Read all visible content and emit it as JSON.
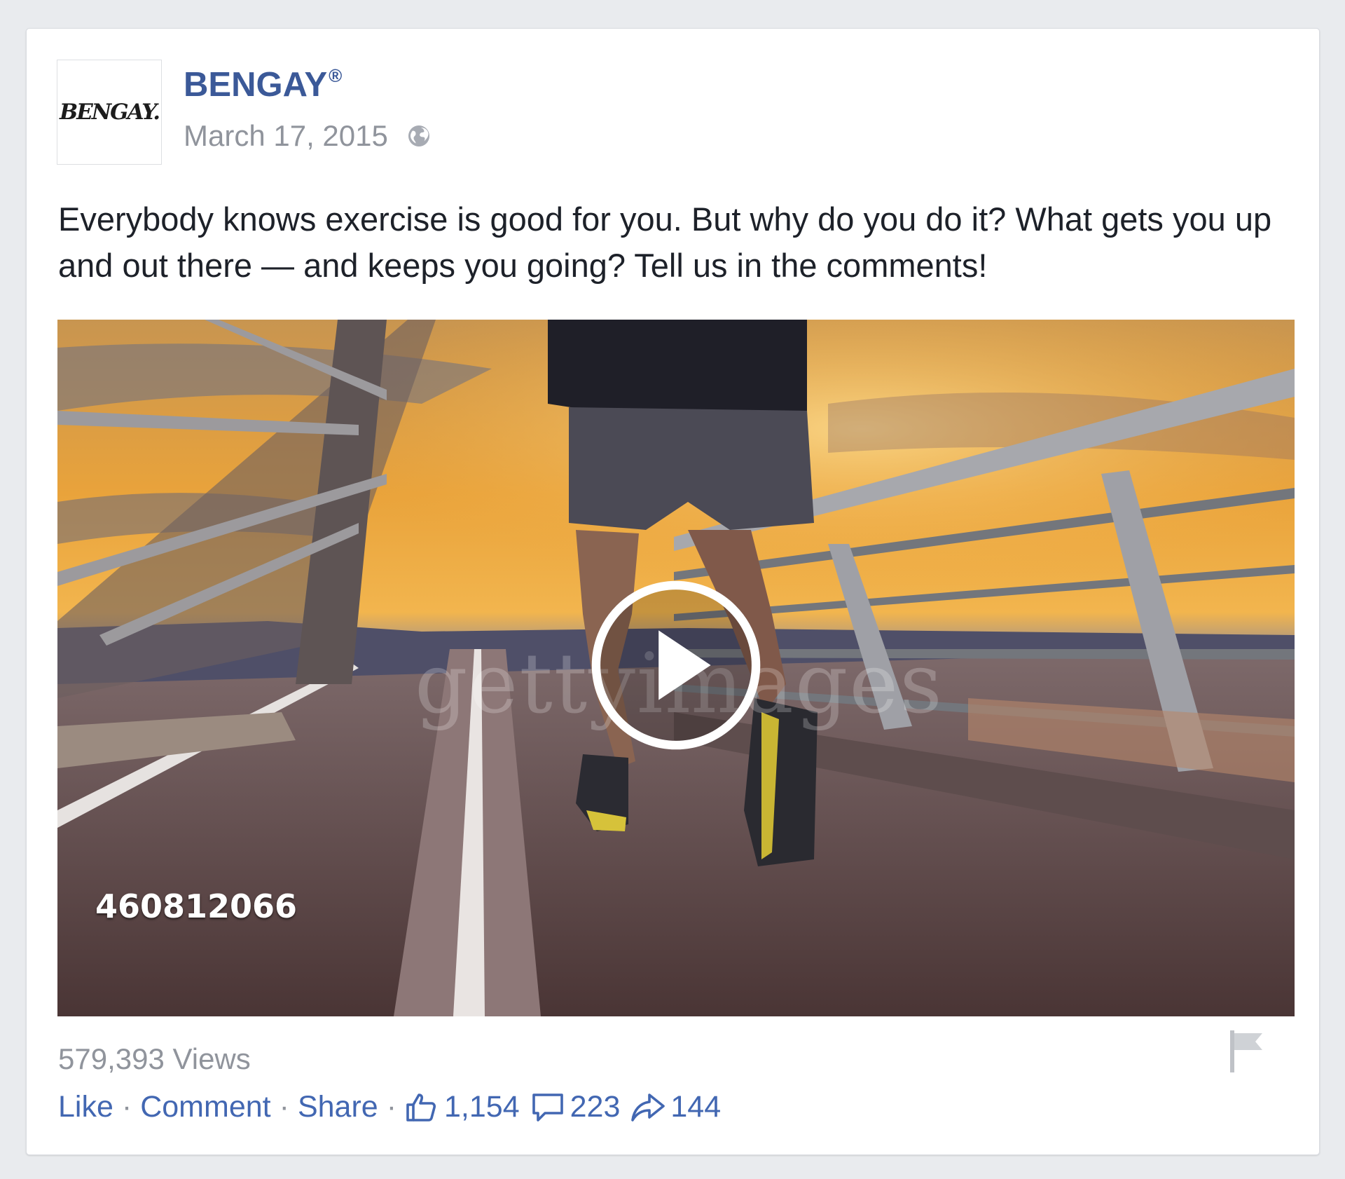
{
  "post": {
    "page_name": "BENGAY",
    "registered_mark": "®",
    "avatar_logo": "BENGAY.",
    "date": "March 17, 2015",
    "text": "Everybody knows exercise is good for you. But why do you do it? What gets you up and out there — and keeps you going? Tell us in the comments!"
  },
  "video": {
    "watermark": "gettyimages",
    "stock_id": "460812066"
  },
  "footer": {
    "views": "579,393 Views",
    "like_label": "Like",
    "comment_label": "Comment",
    "share_label": "Share",
    "separator": "·",
    "like_count": "1,154",
    "comment_count": "223",
    "share_count": "144"
  },
  "icons": {
    "privacy": "globe-icon",
    "play": "play-icon",
    "report": "flag-icon",
    "likes": "thumbs-up-icon",
    "comments": "comment-bubble-icon",
    "shares": "share-arrow-icon"
  },
  "colors": {
    "link_blue": "#4267b2",
    "name_blue": "#3b5998",
    "meta_gray": "#90949c",
    "text": "#1d2129"
  }
}
